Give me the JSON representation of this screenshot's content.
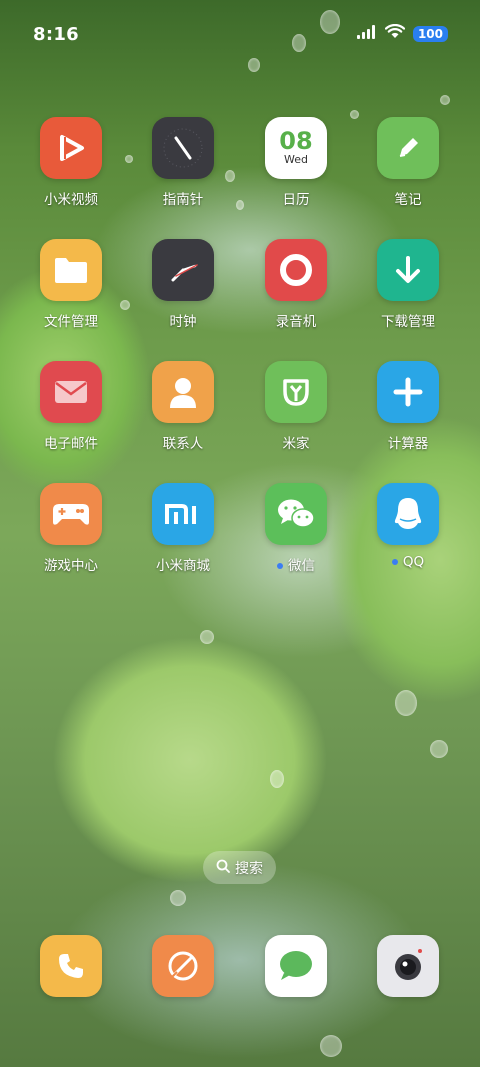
{
  "status_bar": {
    "time": "8:16",
    "battery": "100",
    "icons": [
      "signal-icon",
      "wifi-icon",
      "battery-icon"
    ]
  },
  "apps": [
    {
      "label": "小米视频",
      "icon": "play-icon",
      "color": "#e85a3a"
    },
    {
      "label": "指南针",
      "icon": "compass-icon",
      "color": "#3a3a40"
    },
    {
      "label": "日历",
      "icon": "calendar-icon",
      "color": "#ffffff",
      "date": "08",
      "weekday": "Wed"
    },
    {
      "label": "笔记",
      "icon": "pencil-icon",
      "color": "#6fbf5a"
    },
    {
      "label": "文件管理",
      "icon": "folder-icon",
      "color": "#f4b94a"
    },
    {
      "label": "时钟",
      "icon": "clock-icon",
      "color": "#3a3a40"
    },
    {
      "label": "录音机",
      "icon": "record-icon",
      "color": "#e14a4a"
    },
    {
      "label": "下载管理",
      "icon": "download-icon",
      "color": "#1fb58f"
    },
    {
      "label": "电子邮件",
      "icon": "mail-icon",
      "color": "#e04a4f"
    },
    {
      "label": "联系人",
      "icon": "contact-icon",
      "color": "#f0a24a"
    },
    {
      "label": "米家",
      "icon": "mijia-icon",
      "color": "#6fbf5a"
    },
    {
      "label": "计算器",
      "icon": "plus-icon",
      "color": "#2aa6e6"
    },
    {
      "label": "游戏中心",
      "icon": "gamepad-icon",
      "color": "#f08a4a"
    },
    {
      "label": "小米商城",
      "icon": "mi-icon",
      "color": "#2aa6e6"
    },
    {
      "label": "微信",
      "icon": "wechat-icon",
      "color": "#5cbf5a",
      "notification": true
    },
    {
      "label": "QQ",
      "icon": "qq-icon",
      "color": "#2aa6e6",
      "notification": true
    }
  ],
  "search": {
    "label": "搜索"
  },
  "dock": [
    {
      "name": "phone",
      "icon": "phone-icon",
      "color": "#f4b94a"
    },
    {
      "name": "browser",
      "icon": "browser-icon",
      "color": "#f08a4a"
    },
    {
      "name": "messages",
      "icon": "message-icon",
      "color": "#ffffff"
    },
    {
      "name": "camera",
      "icon": "camera-icon",
      "color": "#e8e8ec"
    }
  ]
}
